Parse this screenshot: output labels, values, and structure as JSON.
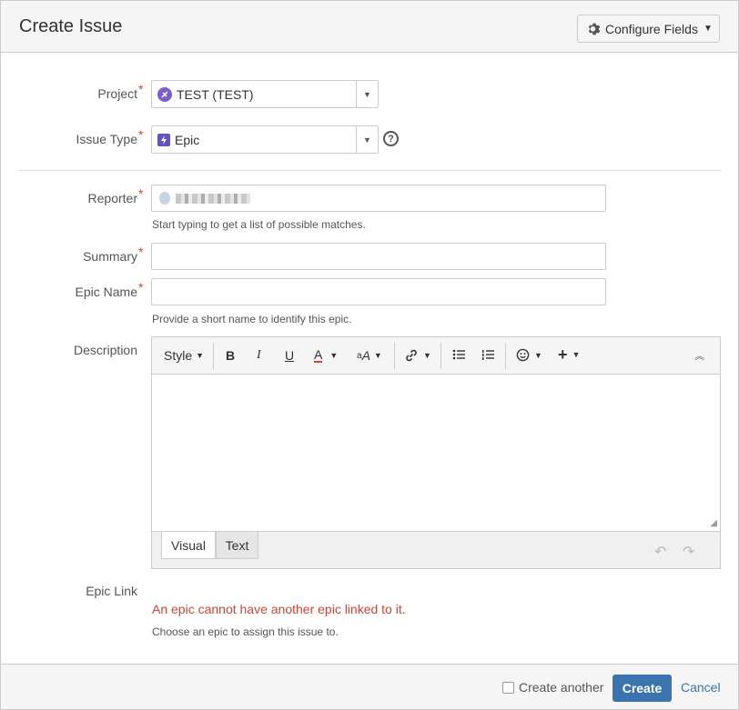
{
  "dialog": {
    "title": "Create Issue",
    "configure_fields_label": "Configure Fields"
  },
  "form": {
    "project": {
      "label": "Project",
      "value": "TEST (TEST)"
    },
    "issue_type": {
      "label": "Issue Type",
      "value": "Epic"
    },
    "reporter": {
      "label": "Reporter",
      "hint": "Start typing to get a list of possible matches."
    },
    "summary": {
      "label": "Summary",
      "value": ""
    },
    "epic_name": {
      "label": "Epic Name",
      "value": "",
      "hint": "Provide a short name to identify this epic."
    },
    "description": {
      "label": "Description",
      "toolbar": {
        "style_label": "Style"
      },
      "tabs": {
        "visual": "Visual",
        "text": "Text"
      }
    },
    "epic_link": {
      "label": "Epic Link",
      "error": "An epic cannot have another epic linked to it.",
      "hint": "Choose an epic to assign this issue to."
    }
  },
  "footer": {
    "create_another_label": "Create another",
    "create_label": "Create",
    "cancel_label": "Cancel"
  },
  "colors": {
    "required": "#d04437",
    "primary": "#3b73af",
    "epic_purple": "#6554c0"
  }
}
